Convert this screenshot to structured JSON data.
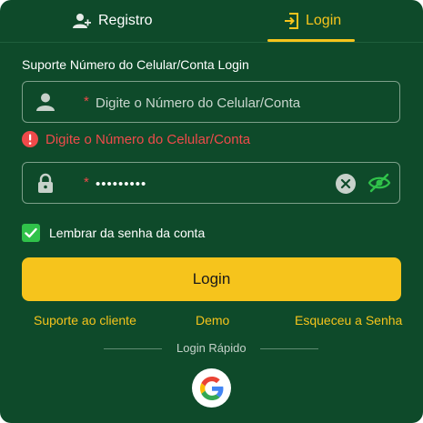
{
  "tabs": {
    "register_label": "Registro",
    "login_label": "Login"
  },
  "form": {
    "section_label": "Suporte Número do Celular/Conta Login",
    "phone": {
      "placeholder": "Digite o Número do Celular/Conta",
      "required_marker": "*"
    },
    "error_message": "Digite o Número do Celular/Conta",
    "password": {
      "value": "•••••••••",
      "required_marker": "*"
    },
    "remember": {
      "label": "Lembrar da senha da conta",
      "checked": true
    },
    "login_button": "Login"
  },
  "links": {
    "support": "Suporte ao cliente",
    "demo": "Demo",
    "forgot": "Esqueceu a Senha"
  },
  "quick_login": {
    "label": "Login Rápido",
    "providers": [
      "google-icon"
    ]
  },
  "colors": {
    "background": "#0e4a2a",
    "accent": "#f6c41c",
    "error": "#ef4a4a",
    "checkbox": "#30c24a"
  }
}
